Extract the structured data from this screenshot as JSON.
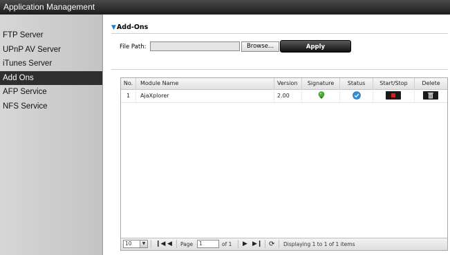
{
  "window": {
    "title": "Application Management"
  },
  "sidebar": {
    "items": [
      {
        "label": "FTP Server",
        "active": false
      },
      {
        "label": "UPnP AV Server",
        "active": false
      },
      {
        "label": "iTunes Server",
        "active": false
      },
      {
        "label": "Add Ons",
        "active": true
      },
      {
        "label": "AFP Service",
        "active": false
      },
      {
        "label": "NFS Service",
        "active": false
      }
    ]
  },
  "addons": {
    "title": "Add-Ons",
    "file_path_label": "File Path:",
    "file_path_value": "",
    "browse_label": "Browse...",
    "apply_label": "Apply"
  },
  "grid": {
    "columns": [
      "No.",
      "Module Name",
      "Version",
      "Signature",
      "Status",
      "Start/Stop",
      "Delete"
    ],
    "rows": [
      {
        "no": "1",
        "module": "AjaXplorer",
        "version": "2.00"
      }
    ],
    "footer": {
      "page_size": "10",
      "page_label": "Page",
      "page_value": "1",
      "of_label": "of 1",
      "displaying": "Displaying 1 to 1 of 1 items"
    }
  },
  "colors": {
    "accent": "#1e7fd6",
    "signature_green": "#49b02e",
    "status_blue": "#2f8fde",
    "stop_red": "#e41b1b"
  }
}
